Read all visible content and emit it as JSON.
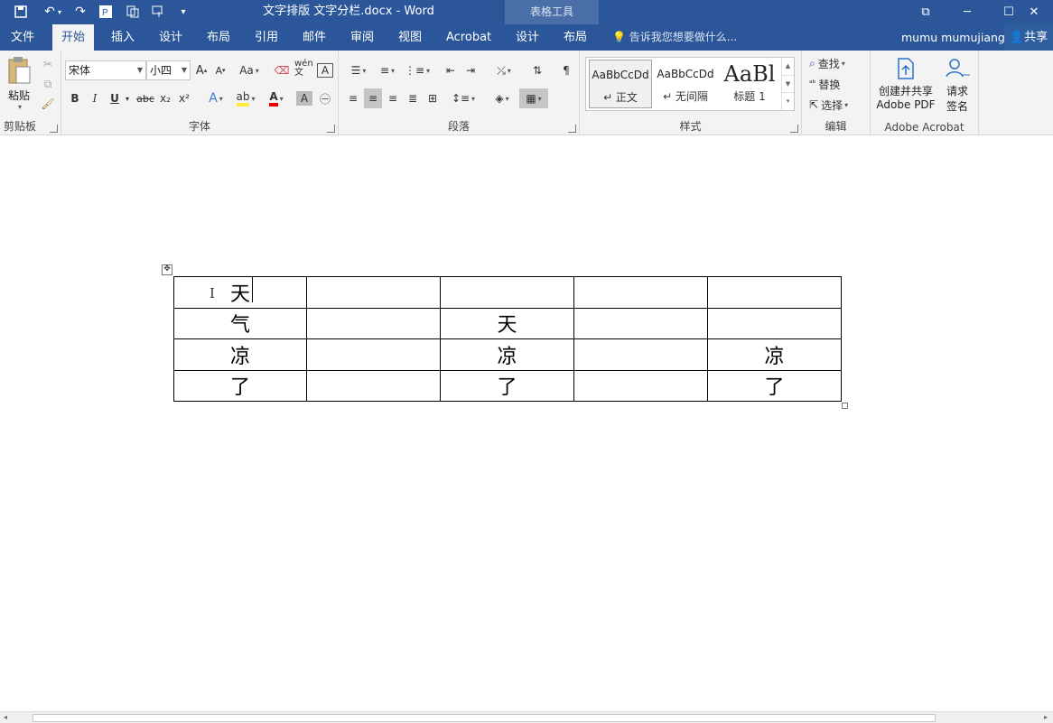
{
  "window": {
    "title": "文字排版   文字分栏.docx - Word",
    "context_tab_header": "表格工具",
    "buttons": {
      "restore": "⧉",
      "minimize": "─",
      "maximize": "☐",
      "close": "✕"
    }
  },
  "qat": {
    "save": "🖫",
    "undo": "↶",
    "redo": "↷",
    "more": "▾"
  },
  "tabs": [
    {
      "label": "文件"
    },
    {
      "label": "开始"
    },
    {
      "label": "插入"
    },
    {
      "label": "设计"
    },
    {
      "label": "布局"
    },
    {
      "label": "引用"
    },
    {
      "label": "邮件"
    },
    {
      "label": "审阅"
    },
    {
      "label": "视图"
    },
    {
      "label": "Acrobat"
    },
    {
      "label": "设计"
    },
    {
      "label": "布局"
    }
  ],
  "tell_me": "告诉我您想要做什么...",
  "user": "mumu mumujiang",
  "share": "共享",
  "ribbon": {
    "clipboard": {
      "label": "剪贴板",
      "paste": "粘贴"
    },
    "font": {
      "label": "字体",
      "font_name": "宋体",
      "font_size": "小四",
      "grow": "A",
      "shrink": "A",
      "case": "Aa",
      "bold": "B",
      "italic": "I",
      "underline": "U",
      "strike": "abc",
      "sub": "x₂",
      "sup": "x²",
      "effects": "A",
      "highlight": "ab",
      "color": "A",
      "shade": "A",
      "enclose": "㊂",
      "pinyin": "wén文",
      "border_char": "A"
    },
    "paragraph": {
      "label": "段落"
    },
    "styles": {
      "label": "样式",
      "items": [
        {
          "sample": "AaBbCcDd",
          "name": "↵ 正文"
        },
        {
          "sample": "AaBbCcDd",
          "name": "↵ 无间隔"
        },
        {
          "sample": "AaBl",
          "name": "标题 1"
        }
      ]
    },
    "editing": {
      "label": "编辑",
      "find": "查找",
      "replace": "替换",
      "select": "选择"
    },
    "acrobat": {
      "label": "Adobe Acrobat",
      "create_line1": "创建并共享",
      "create_line2": "Adobe PDF",
      "sign_line1": "请求",
      "sign_line2": "签名"
    }
  },
  "table": {
    "rows": [
      [
        "天",
        "",
        "",
        "",
        ""
      ],
      [
        "气",
        "",
        "天",
        "",
        ""
      ],
      [
        "凉",
        "",
        "凉",
        "",
        "凉"
      ],
      [
        "了",
        "",
        "了",
        "",
        "了"
      ]
    ]
  }
}
